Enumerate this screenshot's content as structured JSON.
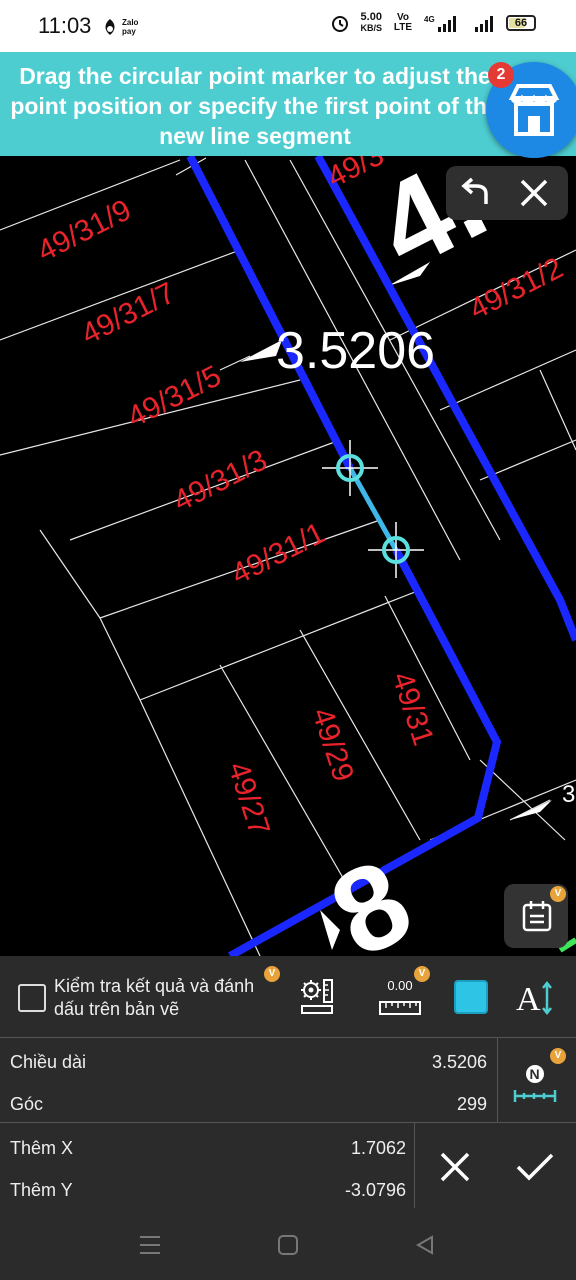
{
  "status_bar": {
    "time": "11:03",
    "zalo_label": "Zalo pay",
    "net_speed": "5.00",
    "net_speed_unit": "KB/S",
    "volte": "Vo LTE",
    "network": "4G",
    "battery": "66"
  },
  "hint_banner": {
    "text": "Drag the circular point marker to adjust the point position or specify the first point of the new line segment",
    "badge_count": "2"
  },
  "drawing": {
    "dimension_label": "3.5206",
    "lot_labels": [
      "49/31/9",
      "49/31/7",
      "49/31/5",
      "49/31/3",
      "49/31/1",
      "49/31",
      "49/29",
      "49/27",
      "49/31/2",
      "49/3"
    ],
    "big_text_top": "4.",
    "big_text_bottom": "8",
    "edge_text": "3",
    "colors": {
      "polyline": "#1a28ff",
      "selected_segment": "#3fb7e8",
      "labels": "#e8232b",
      "grip": "#5be0e0"
    }
  },
  "panel": {
    "check_label": "Kiểm tra kết quả và đánh dấu trên bản vẽ",
    "badge": "V",
    "ruler_value": "0.00",
    "text_tool_label": "A",
    "rows": [
      {
        "label": "Chiều dài",
        "value": "3.5206"
      },
      {
        "label": "Góc",
        "value": "299"
      },
      {
        "label": "Thêm X",
        "value": "1.7062"
      },
      {
        "label": "Thêm Y",
        "value": "-3.0796"
      }
    ],
    "north_label": "N"
  },
  "nav_bar": {
    "icons": [
      "recents-icon",
      "home-icon",
      "back-icon"
    ]
  }
}
